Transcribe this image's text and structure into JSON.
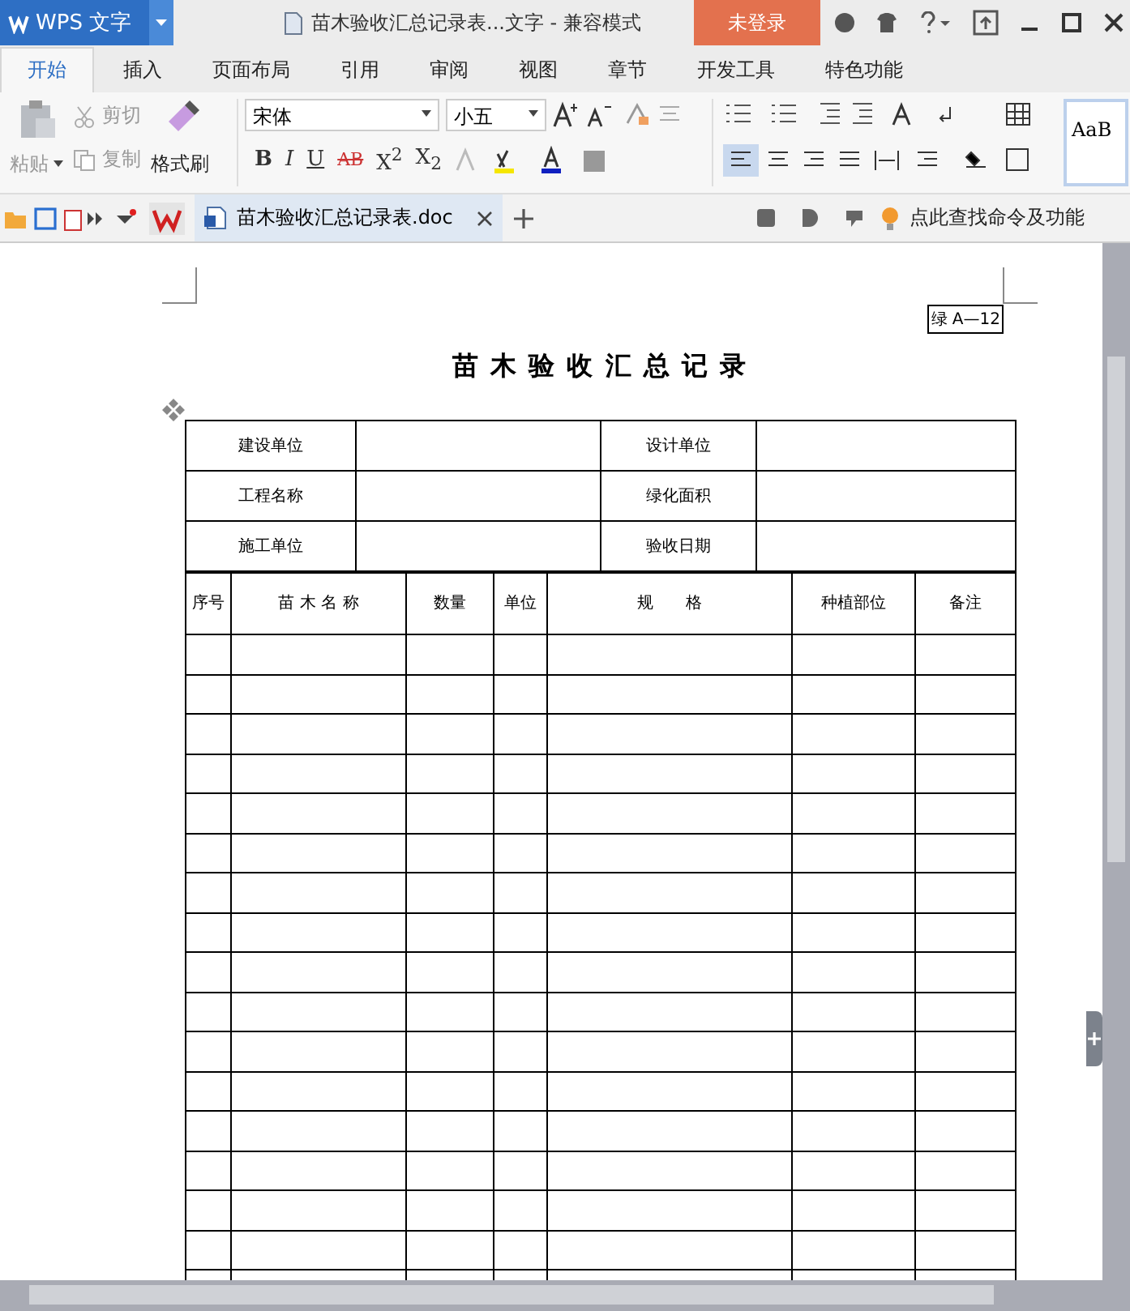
{
  "app": {
    "logo": "WPS 文字"
  },
  "window": {
    "title": "苗木验收汇总记录表...文字 - 兼容模式",
    "login": "未登录"
  },
  "tabs": [
    {
      "label": "开始",
      "selected": true
    },
    {
      "label": "插入",
      "selected": false
    },
    {
      "label": "页面布局",
      "selected": false
    },
    {
      "label": "引用",
      "selected": false
    },
    {
      "label": "审阅",
      "selected": false
    },
    {
      "label": "视图",
      "selected": false
    },
    {
      "label": "章节",
      "selected": false
    },
    {
      "label": "开发工具",
      "selected": false
    },
    {
      "label": "特色功能",
      "selected": false
    }
  ],
  "ribbon": {
    "paste": "粘贴",
    "cut": "剪切",
    "copy": "复制",
    "format_painter": "格式刷",
    "font": "宋体",
    "size": "小五",
    "format_buttons": [
      "B",
      "I",
      "U",
      "AB",
      "X$^{2}$",
      "X$_{2}$"
    ],
    "style_preview": "AaB"
  },
  "doc_tabs": [
    {
      "label": "苗木验收汇总记录表.doc",
      "selected": true
    }
  ],
  "search_hint": "点此查找命令及功能",
  "document": {
    "code": "绿 A—12",
    "title": "苗 木 验 收 汇 总 记 录",
    "info_rows": [
      [
        "建设单位",
        "设计单位"
      ],
      [
        "工程名称",
        "绿化面积"
      ],
      [
        "施工单位",
        "验收日期"
      ]
    ],
    "columns": [
      "序号",
      "苗 木 名 称",
      "数量",
      "单位",
      "规　　格",
      "种植部位",
      "备注"
    ]
  }
}
